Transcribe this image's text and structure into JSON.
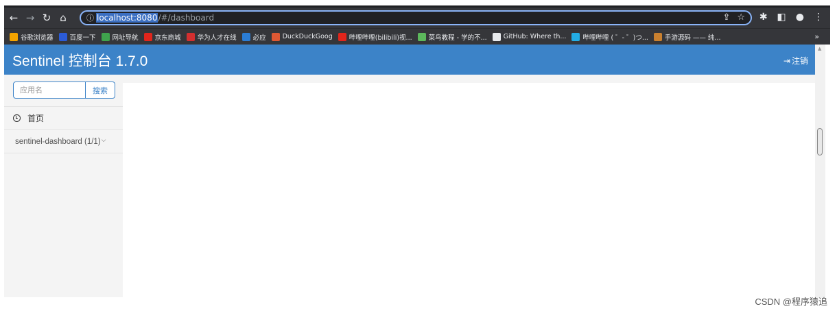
{
  "browser": {
    "url_host": "localhost:8080",
    "url_path": "/#/dashboard",
    "bookmarks": [
      {
        "label": "谷歌浏览器",
        "color": "#f4a400",
        "icon": "chrome-icon"
      },
      {
        "label": "百度一下",
        "color": "#2b5bd7",
        "icon": "baidu-icon"
      },
      {
        "label": "网址导航",
        "color": "#3fa34d",
        "icon": "home-icon"
      },
      {
        "label": "京东商城",
        "color": "#e1251b",
        "icon": "jd-icon"
      },
      {
        "label": "华为人才在线",
        "color": "#d32f2f",
        "icon": "huawei-icon"
      },
      {
        "label": "必应",
        "color": "#2b7cd3",
        "icon": "bing-icon"
      },
      {
        "label": "DuckDuckGoog",
        "color": "#de5833",
        "icon": "duckduckgo-icon"
      },
      {
        "label": "哔哩哔哩(bilibili)视...",
        "color": "#e1251b",
        "icon": "bilibili-icon"
      },
      {
        "label": "菜鸟教程 - 学的不...",
        "color": "#5cb85c",
        "icon": "runoob-icon"
      },
      {
        "label": "GitHub: Where th...",
        "color": "#e8eaed",
        "icon": "github-icon"
      },
      {
        "label": "哔哩哔哩 ( ゜- ゜)つ...",
        "color": "#23ade5",
        "icon": "bilibili-tv-icon"
      },
      {
        "label": "手游源码 —— 纯...",
        "color": "#c9802f",
        "icon": "game-icon"
      }
    ],
    "more_label": "»"
  },
  "app": {
    "title": "Sentinel 控制台 1.7.0",
    "logout_label": "注销",
    "accent": "#3c83c8"
  },
  "sidebar": {
    "search_placeholder": "应用名",
    "search_button": "搜索",
    "home_label": "首页",
    "app_item_label": "sentinel-dashboard (1/1)"
  },
  "watermark": "CSDN @程序猿追"
}
